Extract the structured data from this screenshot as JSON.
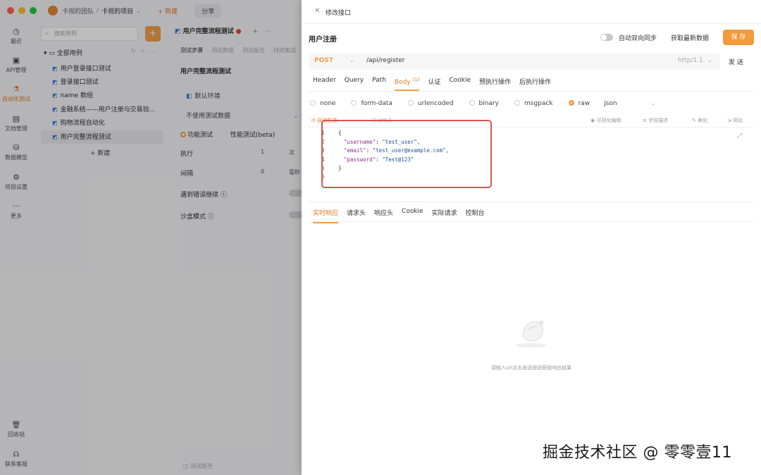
{
  "titlebar": {
    "traffic_colors": [
      "#ff5f57",
      "#febc2e",
      "#28c840"
    ],
    "team": "卡视的团队",
    "separator": "/",
    "project": "卡视的项目",
    "new_label": "+ 新建",
    "share_label": "分享"
  },
  "rail": {
    "items": [
      {
        "label": "最近",
        "icon": "clock-icon"
      },
      {
        "label": "API管理",
        "icon": "api-icon"
      },
      {
        "label": "自动化测试",
        "icon": "flask-icon"
      },
      {
        "label": "文档管理",
        "icon": "document-icon"
      },
      {
        "label": "数据模型",
        "icon": "database-icon"
      },
      {
        "label": "项目设置",
        "icon": "settings-icon"
      },
      {
        "label": "更多",
        "icon": "more-icon"
      }
    ],
    "bottom": [
      {
        "label": "回收站",
        "icon": "trash-icon"
      },
      {
        "label": "联系客服",
        "icon": "headset-icon"
      }
    ]
  },
  "tree": {
    "search_placeholder": "搜索用例",
    "add_label": "+",
    "root_label": "全部用例",
    "items": [
      "用户登录接口测试",
      "登录接口测试",
      "name 数组",
      "金融系统——用户注册与交易验...",
      "购物流程自动化",
      "用户完整流程测试"
    ],
    "new_label": "+ 新建"
  },
  "middle": {
    "tab_title": "用户完整流程测试",
    "tab_dot": "●",
    "subtabs": [
      "测试步骤",
      "测试数据",
      "测试报告",
      "持续集成"
    ],
    "title": "用户完整流程测试",
    "env": "默认环境",
    "no_data": "不使用测试数据",
    "mode_functional": "功能测试",
    "mode_performance": "性能测试(beta)",
    "run_label": "执行",
    "run_value": "1",
    "run_unit": "次",
    "interval_label": "间隔",
    "interval_value": "0",
    "interval_unit": "毫秒",
    "on_error_label": "遇到错误继续",
    "sandbox_label": "沙盒模式",
    "report_label": "测试报告"
  },
  "drawer": {
    "header_title": "修改接口",
    "api_name": "用户注册",
    "sync_label": "自动双向同步",
    "fetch_label": "获取最新数据",
    "save_label": "保 存",
    "method": "POST",
    "url": "/api/register",
    "protocol": "http/1.1",
    "send_label": "发 送",
    "req_tabs": [
      "Header",
      "Query",
      "Path",
      "Body",
      "认证",
      "Cookie",
      "预执行操作",
      "后执行操作"
    ],
    "body_count": "(1)",
    "body_types": [
      "none",
      "form-data",
      "urlencoded",
      "binary",
      "msgpack",
      "raw"
    ],
    "body_format": "json",
    "editor_left": "自动生成",
    "editor_left2": "自动格式",
    "editor_tools": [
      "可视化编辑",
      "字段描述",
      "美化",
      "简化"
    ],
    "code": [
      {
        "n": "1",
        "t": "{"
      },
      {
        "n": "2",
        "k": "\"username\"",
        "v": "\"test_user\","
      },
      {
        "n": "3",
        "k": "\"email\"",
        "v": "\"test_user@example.com\","
      },
      {
        "n": "4",
        "k": "\"password\"",
        "v": "\"Test@123\""
      },
      {
        "n": "5",
        "t": "}"
      },
      {
        "n": "6",
        "t": ""
      }
    ],
    "resp_tabs": [
      "实时响应",
      "请求头",
      "响应头",
      "Cookie",
      "实际请求",
      "控制台"
    ],
    "empty_text": "请输入url点击发送按钮获取响应结果"
  },
  "watermark": "掘金技术社区 @ 零零壹11",
  "colors": {
    "accent": "#f39a3d",
    "highlight": "#d9534f",
    "link": "#3b7bd8"
  }
}
